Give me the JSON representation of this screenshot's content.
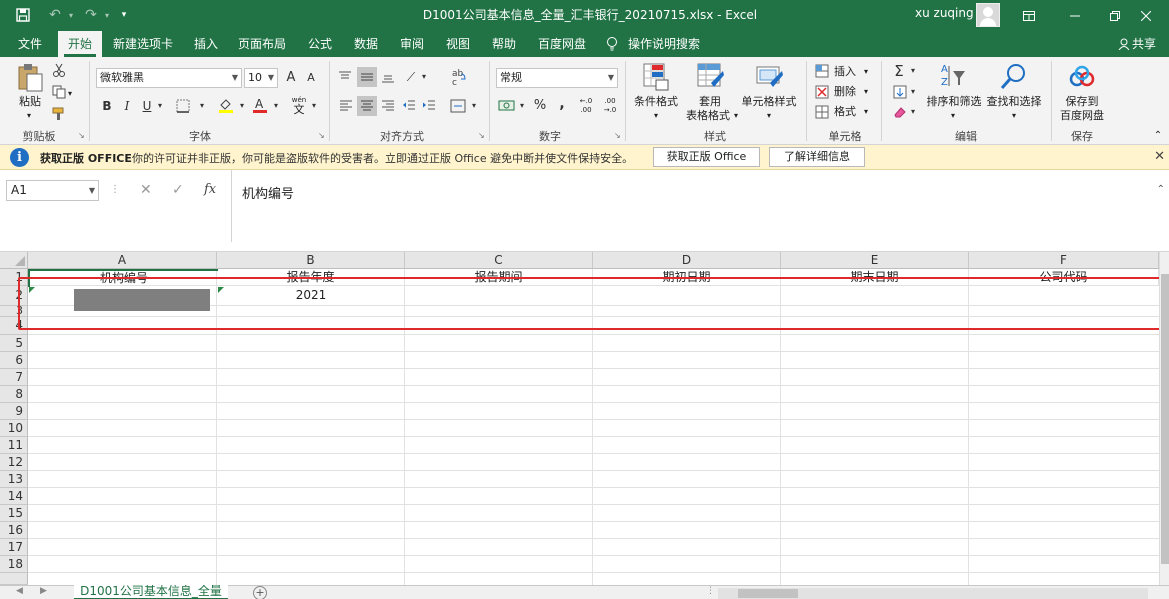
{
  "window": {
    "title": "D1001公司基本信息_全量_汇丰银行_20210715.xlsx  -  Excel",
    "user": "xu zuqing"
  },
  "tabs": [
    "文件",
    "开始",
    "新建选项卡",
    "插入",
    "页面布局",
    "公式",
    "数据",
    "审阅",
    "视图",
    "帮助",
    "百度网盘"
  ],
  "tell_me": "操作说明搜索",
  "share": "共享",
  "ribbon": {
    "clipboard": {
      "label": "剪贴板",
      "paste": "粘贴"
    },
    "font": {
      "label": "字体",
      "name": "微软雅黑",
      "size": "10",
      "bold": "B",
      "italic": "I",
      "underline": "U",
      "grow": "A",
      "shrink": "A",
      "wen": "wén",
      "wen_char": "文"
    },
    "alignment": {
      "label": "对齐方式",
      "ab": "ab",
      "c": "c"
    },
    "number": {
      "label": "数字",
      "format": "常规",
      "percent": "%",
      "comma": ",",
      "inc": ".0 .00",
      "inc2": ".00",
      "dec": ".00 .0",
      "dec2": ".0"
    },
    "styles": {
      "label": "样式",
      "conditional": "条件格式",
      "table1": "套用",
      "table2": "表格格式",
      "cell_styles": "单元格样式"
    },
    "cells": {
      "label": "单元格",
      "insert": "插入",
      "delete": "删除",
      "format": "格式"
    },
    "editing": {
      "label": "编辑",
      "sort": "排序和筛选",
      "find": "查找和选择",
      "sigma": "Σ",
      "sort_a": "A",
      "sort_z": "Z"
    },
    "save": {
      "label": "保存",
      "line1": "保存到",
      "line2": "百度网盘"
    }
  },
  "notice": {
    "title": "获取正版 OFFICE",
    "message": "你的许可证并非正版，你可能是盗版软件的受害者。立即通过正版 Office 避免中断并使文件保持安全。",
    "btn1": "获取正版 Office",
    "btn2": "了解详细信息"
  },
  "formula_bar": {
    "name_box": "A1",
    "content": "机构编号",
    "fx": "fx"
  },
  "grid": {
    "columns": [
      "A",
      "B",
      "C",
      "D",
      "E",
      "F"
    ],
    "rows": [
      "1",
      "2",
      "3",
      "4",
      "5",
      "6",
      "7",
      "8",
      "9",
      "10",
      "11",
      "12",
      "13",
      "14",
      "15",
      "16",
      "17",
      "18"
    ],
    "header_row": [
      "机构编号",
      "报告年度",
      "报告期间",
      "期初日期",
      "期末日期",
      "公司代码"
    ],
    "row2": [
      "",
      "2021",
      "",
      "",
      "",
      ""
    ]
  },
  "sheet_tab": "D1001公司基本信息_全量",
  "colors": {
    "accent": "#217346",
    "highlight": "#e0292b"
  }
}
